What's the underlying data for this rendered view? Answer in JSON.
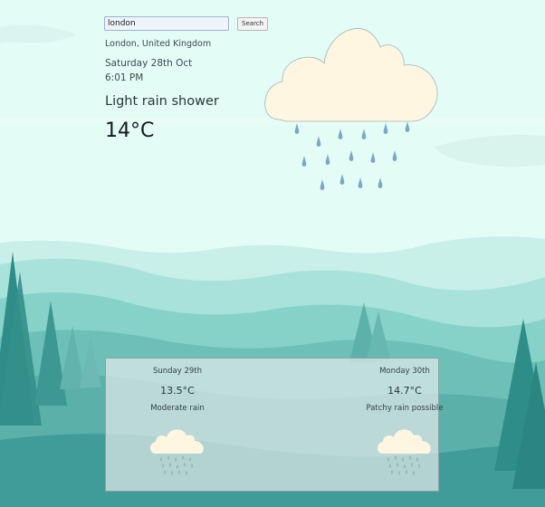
{
  "search": {
    "value": "london",
    "button_label": "Search"
  },
  "current": {
    "location": "London, United Kingdom",
    "date": "Saturday 28th Oct",
    "time": "6:01 PM",
    "condition": "Light rain shower",
    "temperature": "14°C",
    "icon": "rain-cloud-icon"
  },
  "forecast": [
    {
      "day": "Sunday 29th",
      "temperature": "13.5°C",
      "condition": "Moderate rain",
      "icon": "rain-cloud-icon"
    },
    {
      "day": "Monday 30th",
      "temperature": "14.7°C",
      "condition": "Patchy rain possible",
      "icon": "rain-cloud-icon"
    }
  ],
  "colors": {
    "sky": "#e4fcf6",
    "cloud": "#fef6e1",
    "rain": "#7aa6c8",
    "hills": "#5fb7b0",
    "trees": "#2f8d89"
  }
}
